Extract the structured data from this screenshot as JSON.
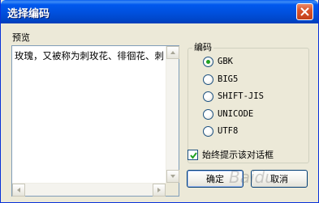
{
  "window": {
    "title": "选择编码"
  },
  "preview": {
    "label": "预览",
    "text": "玫瑰，又被称为刺玫花、徘徊花、刺"
  },
  "encoding_group": {
    "title": "编码",
    "options": [
      {
        "label": "GBK",
        "selected": true
      },
      {
        "label": "BIG5",
        "selected": false
      },
      {
        "label": "SHIFT-JIS",
        "selected": false
      },
      {
        "label": "UNICODE",
        "selected": false
      },
      {
        "label": "UTF8",
        "selected": false
      }
    ]
  },
  "always_prompt": {
    "label": "始终提示该对话框",
    "checked": true
  },
  "buttons": {
    "ok": "确定",
    "cancel": "取消"
  },
  "colors": {
    "title_bar": "#0058ee",
    "close_button": "#d9542c",
    "dialog_bg": "#ece9d8"
  }
}
